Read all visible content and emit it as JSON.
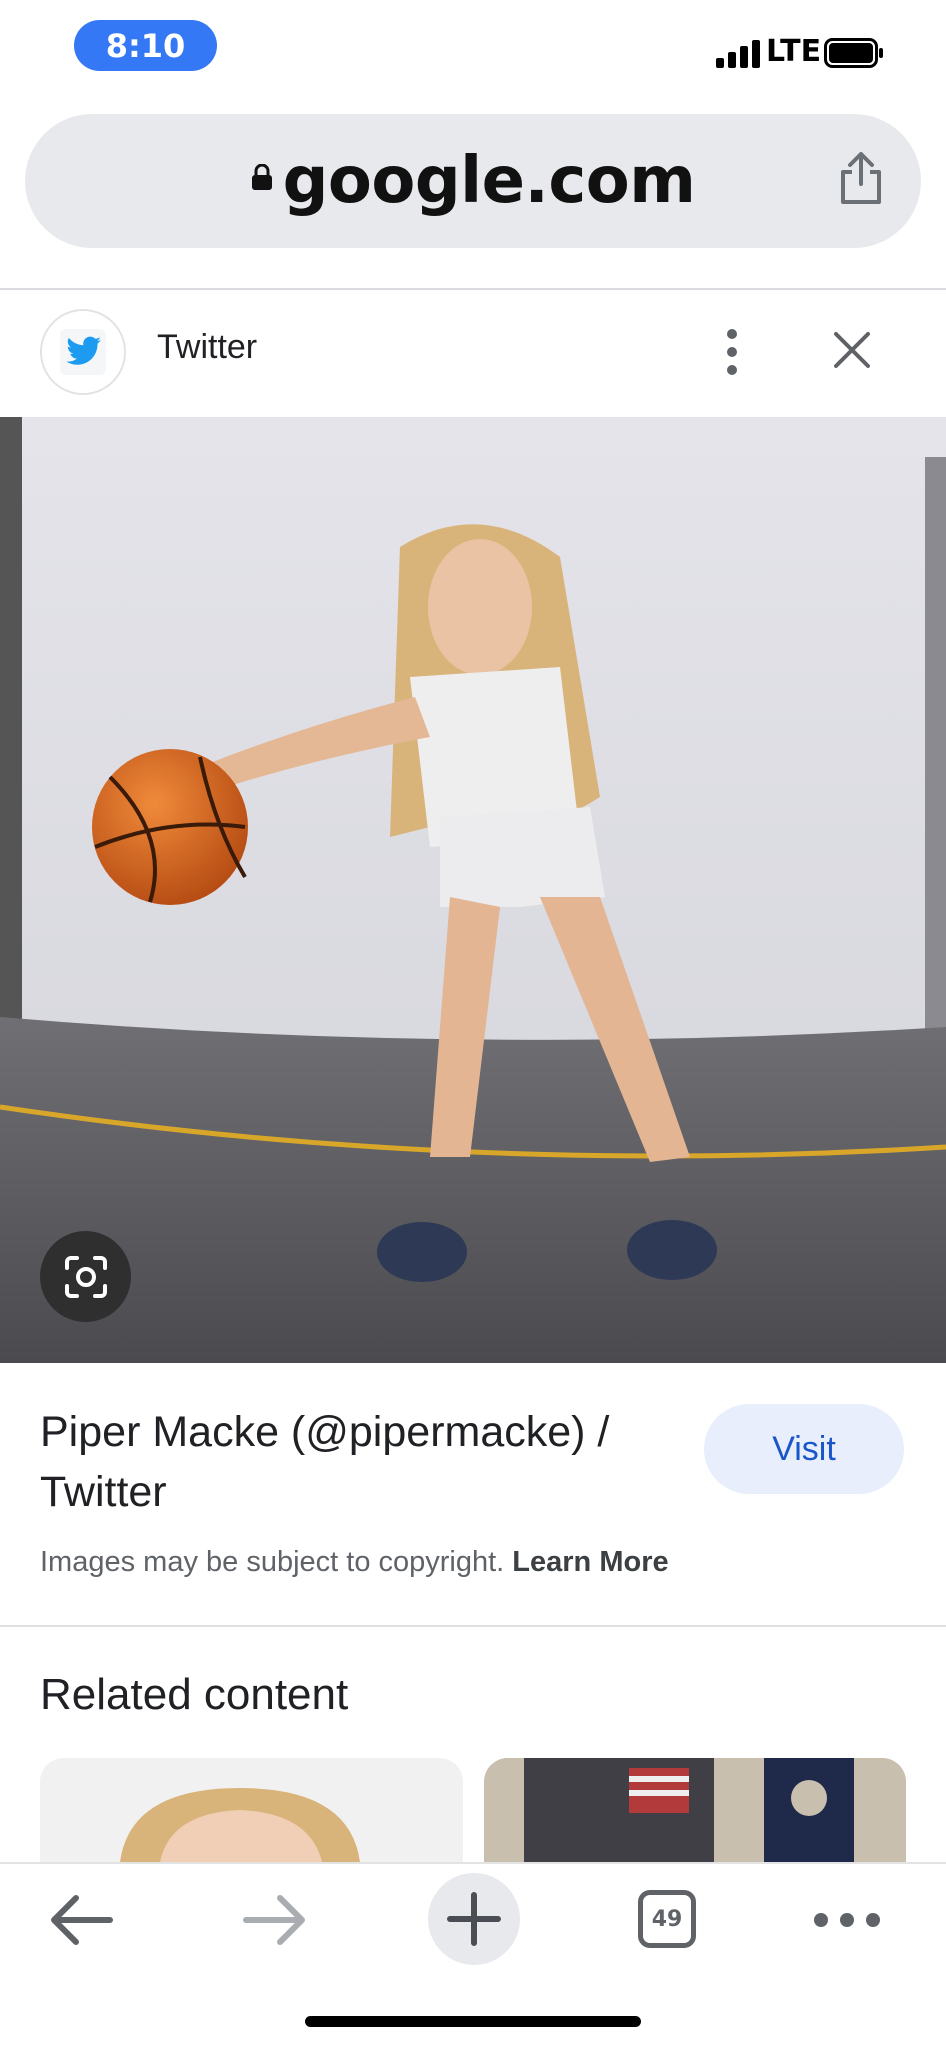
{
  "status_bar": {
    "time": "8:10",
    "network": "LTE"
  },
  "browser": {
    "url": "google.com",
    "open_tabs": "49"
  },
  "source": {
    "name": "Twitter"
  },
  "result": {
    "title": "Piper Macke (@pipermacke) / Twitter",
    "visit_label": "Visit",
    "copyright_text": "Images may be subject to copyright.",
    "learn_more_label": "Learn More"
  },
  "related": {
    "heading": "Related content"
  },
  "icons": {
    "lock": "lock-icon",
    "share": "share-icon",
    "twitter": "twitter-bird-icon",
    "more": "more-vert-icon",
    "close": "close-icon",
    "lens": "lens-icon",
    "back": "arrow-left-icon",
    "forward": "arrow-right-icon",
    "new_tab": "plus-icon",
    "menu": "more-horiz-icon"
  },
  "colors": {
    "status_pill": "#3478f6",
    "visit_bg": "#e8eefc",
    "visit_text": "#1a56c9",
    "twitter_blue": "#1d9bf0"
  }
}
